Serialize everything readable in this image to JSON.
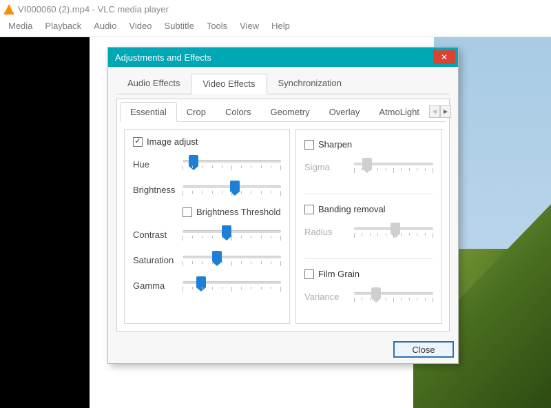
{
  "window": {
    "title": "VI000060 (2).mp4 - VLC media player"
  },
  "menu": [
    "Media",
    "Playback",
    "Audio",
    "Video",
    "Subtitle",
    "Tools",
    "View",
    "Help"
  ],
  "dialog": {
    "title": "Adjustments and Effects",
    "close_glyph": "✕",
    "close_label": "Close",
    "main_tabs": [
      "Audio Effects",
      "Video Effects",
      "Synchronization"
    ],
    "main_active": 1,
    "sub_tabs": [
      "Essential",
      "Crop",
      "Colors",
      "Geometry",
      "Overlay",
      "AtmoLight"
    ],
    "sub_active": 0,
    "arrow_left": "◄",
    "arrow_right": "►",
    "image_adjust": {
      "label": "Image adjust",
      "checked": true,
      "sliders": {
        "hue": {
          "label": "Hue",
          "pos": 6
        },
        "brightness": {
          "label": "Brightness",
          "pos": 48
        },
        "contrast": {
          "label": "Contrast",
          "pos": 40
        },
        "saturation": {
          "label": "Saturation",
          "pos": 30
        },
        "gamma": {
          "label": "Gamma",
          "pos": 14
        }
      },
      "brightness_threshold": {
        "label": "Brightness Threshold",
        "checked": false
      }
    },
    "sharpen": {
      "label": "Sharpen",
      "checked": false,
      "slider": {
        "label": "Sigma",
        "pos": 10
      }
    },
    "banding": {
      "label": "Banding removal",
      "checked": false,
      "slider": {
        "label": "Radius",
        "pos": 46
      }
    },
    "filmgrain": {
      "label": "Film Grain",
      "checked": false,
      "slider": {
        "label": "Variance",
        "pos": 22
      }
    }
  }
}
